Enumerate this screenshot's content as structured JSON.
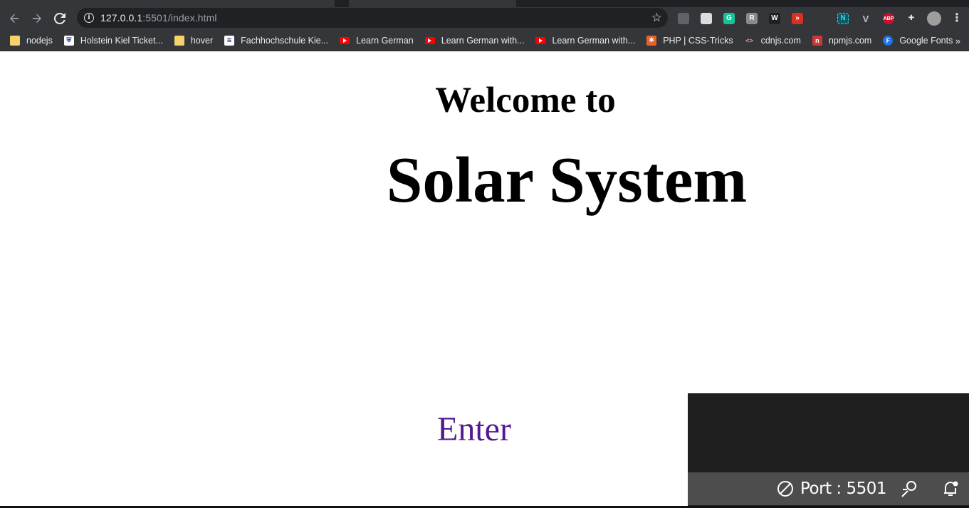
{
  "browser": {
    "url_host": "127.0.0.1",
    "url_rest": ":5501/index.html",
    "extensions": [
      {
        "name": "camera-extension-icon",
        "glyph": "",
        "color": "#5f6368"
      },
      {
        "name": "document-extension-icon",
        "glyph": "",
        "color": "#dadce0"
      },
      {
        "name": "grammarly-extension-icon",
        "glyph": "G",
        "color": "#15c39a"
      },
      {
        "name": "font-extension-icon",
        "glyph": "R",
        "color": "#8a8a8a"
      },
      {
        "name": "wordtune-extension-icon",
        "glyph": "W",
        "color": "#202124"
      },
      {
        "name": "forward-extension-icon",
        "glyph": "»",
        "color": "#d93025"
      },
      {
        "name": "color-picker-extension-icon",
        "glyph": "",
        "color": "#35363a"
      },
      {
        "name": "n-extension-icon",
        "glyph": "N",
        "color": "#0b5f6b"
      },
      {
        "name": "vue-extension-icon",
        "glyph": "V",
        "color": "#35363a"
      },
      {
        "name": "adblock-extension-icon",
        "glyph": "ABP",
        "color": "#c8102e"
      },
      {
        "name": "puzzle-extension-icon",
        "glyph": "",
        "color": "#35363a"
      },
      {
        "name": "profile-avatar-icon",
        "glyph": "",
        "color": "#9e9e9e"
      },
      {
        "name": "kebab-menu-icon",
        "glyph": "⋮",
        "color": "#35363a"
      }
    ]
  },
  "bookmarks": [
    {
      "label": "nodejs",
      "icon": "folder"
    },
    {
      "label": "Holstein Kiel Ticket...",
      "icon": "holstein"
    },
    {
      "label": "hover",
      "icon": "folder"
    },
    {
      "label": "Fachhochschule Kie...",
      "icon": "fh"
    },
    {
      "label": "Learn German",
      "icon": "youtube"
    },
    {
      "label": "Learn German with...",
      "icon": "youtube"
    },
    {
      "label": "Learn German with...",
      "icon": "youtube"
    },
    {
      "label": "PHP | CSS-Tricks",
      "icon": "csstricks"
    },
    {
      "label": "cdnjs.com",
      "icon": "code"
    },
    {
      "label": "npmjs.com",
      "icon": "npm"
    },
    {
      "label": "Google Fonts",
      "icon": "gfonts"
    }
  ],
  "page": {
    "welcome": "Welcome to",
    "title": "Solar System",
    "enter": "Enter"
  },
  "statusbar": {
    "port": "Port : 5501"
  },
  "colors": {
    "link_visited": "#551a8b",
    "chrome_dark": "#35363a",
    "omnibox": "#202124",
    "status_gray": "#4d4d4d"
  }
}
